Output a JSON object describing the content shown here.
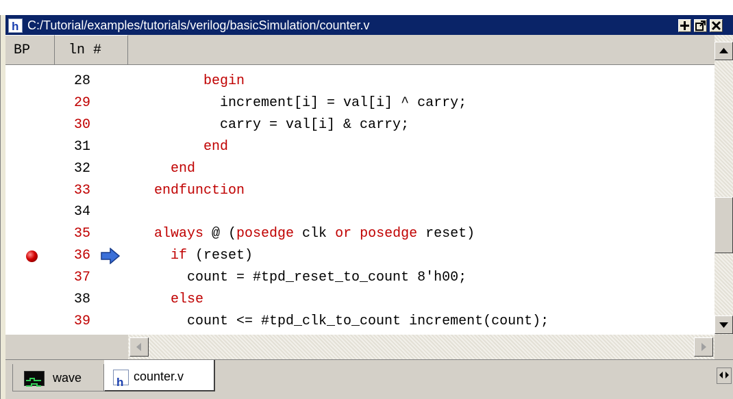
{
  "window": {
    "title": "C:/Tutorial/examples/tutorials/verilog/basicSimulation/counter.v",
    "icon": "h-source-icon",
    "buttons": [
      "maximize-icon",
      "undock-icon",
      "close-icon"
    ]
  },
  "header": {
    "bp_label": "BP",
    "ln_label": "ln #"
  },
  "code_lines": [
    {
      "ln": "28",
      "ln_color": "#000000",
      "segments": [
        {
          "t": "        begin",
          "c": "k"
        }
      ]
    },
    {
      "ln": "29",
      "ln_color": "#c00000",
      "segments": [
        {
          "t": "          increment[i] = val[i] ^ carry;",
          "c": "n"
        }
      ]
    },
    {
      "ln": "30",
      "ln_color": "#c00000",
      "segments": [
        {
          "t": "          carry = val[i] & carry;",
          "c": "n"
        }
      ]
    },
    {
      "ln": "31",
      "ln_color": "#000000",
      "segments": [
        {
          "t": "        end",
          "c": "k"
        }
      ]
    },
    {
      "ln": "32",
      "ln_color": "#000000",
      "segments": [
        {
          "t": "    end",
          "c": "k"
        }
      ]
    },
    {
      "ln": "33",
      "ln_color": "#c00000",
      "segments": [
        {
          "t": "  endfunction",
          "c": "k"
        }
      ]
    },
    {
      "ln": "34",
      "ln_color": "#000000",
      "segments": []
    },
    {
      "ln": "35",
      "ln_color": "#c00000",
      "segments": [
        {
          "t": "  always",
          "c": "k"
        },
        {
          "t": " @ (",
          "c": "n"
        },
        {
          "t": "posedge",
          "c": "k"
        },
        {
          "t": " clk ",
          "c": "n"
        },
        {
          "t": "or",
          "c": "k"
        },
        {
          "t": " ",
          "c": "n"
        },
        {
          "t": "posedge",
          "c": "k"
        },
        {
          "t": " reset)",
          "c": "n"
        }
      ]
    },
    {
      "ln": "36",
      "ln_color": "#c00000",
      "breakpoint": true,
      "current": true,
      "segments": [
        {
          "t": "    if",
          "c": "k"
        },
        {
          "t": " (reset)",
          "c": "n"
        }
      ]
    },
    {
      "ln": "37",
      "ln_color": "#c00000",
      "segments": [
        {
          "t": "      count = #tpd_reset_to_count 8'h00;",
          "c": "n"
        }
      ]
    },
    {
      "ln": "38",
      "ln_color": "#000000",
      "segments": [
        {
          "t": "    else",
          "c": "k"
        }
      ]
    },
    {
      "ln": "39",
      "ln_color": "#c00000",
      "segments": [
        {
          "t": "      count <= #tpd_clk_to_count increment(count);",
          "c": "n"
        }
      ]
    }
  ],
  "vertical_scroll": {
    "position_fraction": 0.58
  },
  "tabs": [
    {
      "label": "wave",
      "icon": "wave-icon",
      "active": false
    },
    {
      "label": "counter.v",
      "icon": "h-source-icon",
      "active": true
    }
  ],
  "colors": {
    "titlebar": "#0a2468",
    "keyword": "#c00000",
    "text": "#000000",
    "breakpoint": "#cc0000",
    "arrow": "#3a6fd8"
  }
}
